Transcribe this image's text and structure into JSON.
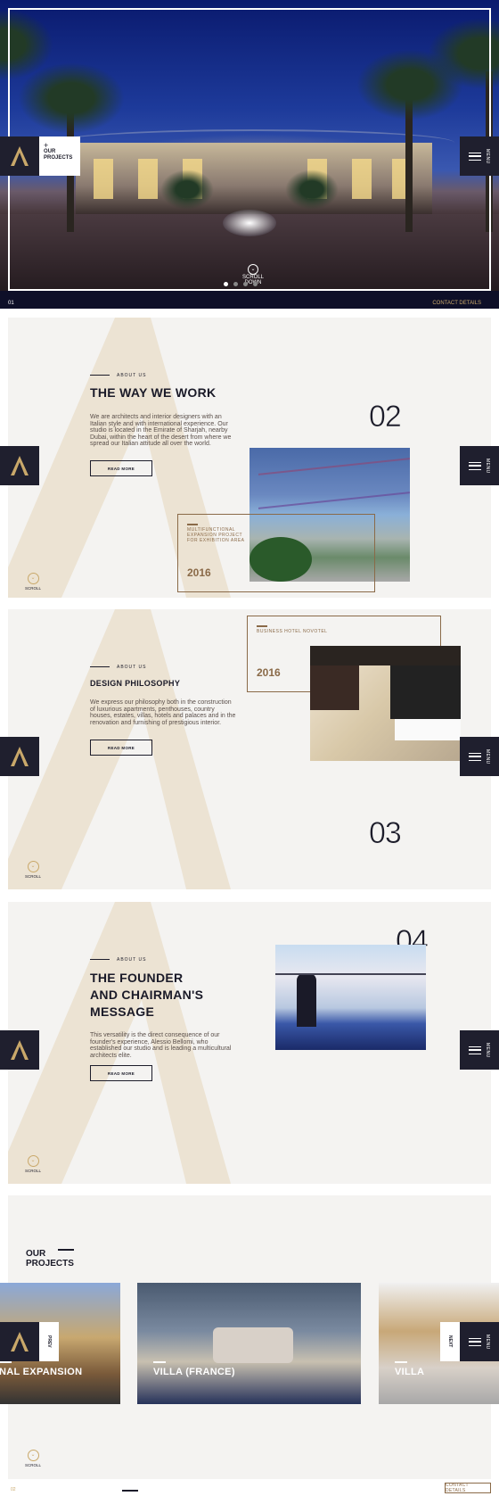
{
  "hero": {
    "slide_number": "01",
    "contact_label": "CONTACT DETAILS",
    "scroll_label": "SCROLL DOWN",
    "projects_tab": "OUR PROJECTS",
    "menu_label": "MENU",
    "active_dot": 1,
    "dot_count": 4
  },
  "about1": {
    "eyebrow": "ABOUT US",
    "title": "THE WAY WE WORK",
    "body": "We are architects and interior designers with an Italian style and with international experience. Our studio is located in the Emirate of Sharjah, nearby Dubai, within the heart of the desert from where we spread our Italian attitude all over the world.",
    "button": "READ MORE",
    "number": "02",
    "caption": "MULTIFUNCTIONAL EXPANSION PROJECT FOR EXHIBITION AREA",
    "year": "2016",
    "scroll_label": "SCROLL"
  },
  "about2": {
    "eyebrow": "ABOUT US",
    "title": "DESIGN PHILOSOPHY",
    "body": "We express our philosophy both in the construction of luxurious apartments, penthouses, country houses, estates, villas, hotels and palaces and in the renovation and furnishing of prestigious interior.",
    "button": "READ MORE",
    "number": "03",
    "caption": "BUSINESS HOTEL NOVOTEL",
    "year": "2016",
    "scroll_label": "SCROLL"
  },
  "about3": {
    "eyebrow": "ABOUT US",
    "title_line1": "THE FOUNDER",
    "title_line2": "AND CHAIRMAN'S",
    "title_line3": "MESSAGE",
    "body": "This versatility is the direct consequence of our founder's experience, Alessio Bellomi, who established our studio and is leading a multicultural architects elite.",
    "button": "READ MORE",
    "number": "04",
    "scroll_label": "SCROLL"
  },
  "projects": {
    "title_line1": "OUR",
    "title_line2": "PROJECTS",
    "cards": [
      {
        "label": "NAL EXPANSION"
      },
      {
        "label": "VILLA (FRANCE)"
      },
      {
        "label": "VILLA"
      }
    ],
    "prev_label": "PREV",
    "next_label": "NEXT",
    "scroll_label": "SCROLL"
  },
  "footer": {
    "number": "02",
    "contact_label": "CONTACT DETAILS"
  },
  "colors": {
    "navy": "#1f1f2e",
    "gold": "#c9a86a",
    "bronze": "#8a6a48",
    "panel": "#f4f3f1"
  },
  "icons": [
    "logo-a-icon",
    "menu-icon",
    "chevron-down-icon",
    "plus-icon"
  ]
}
